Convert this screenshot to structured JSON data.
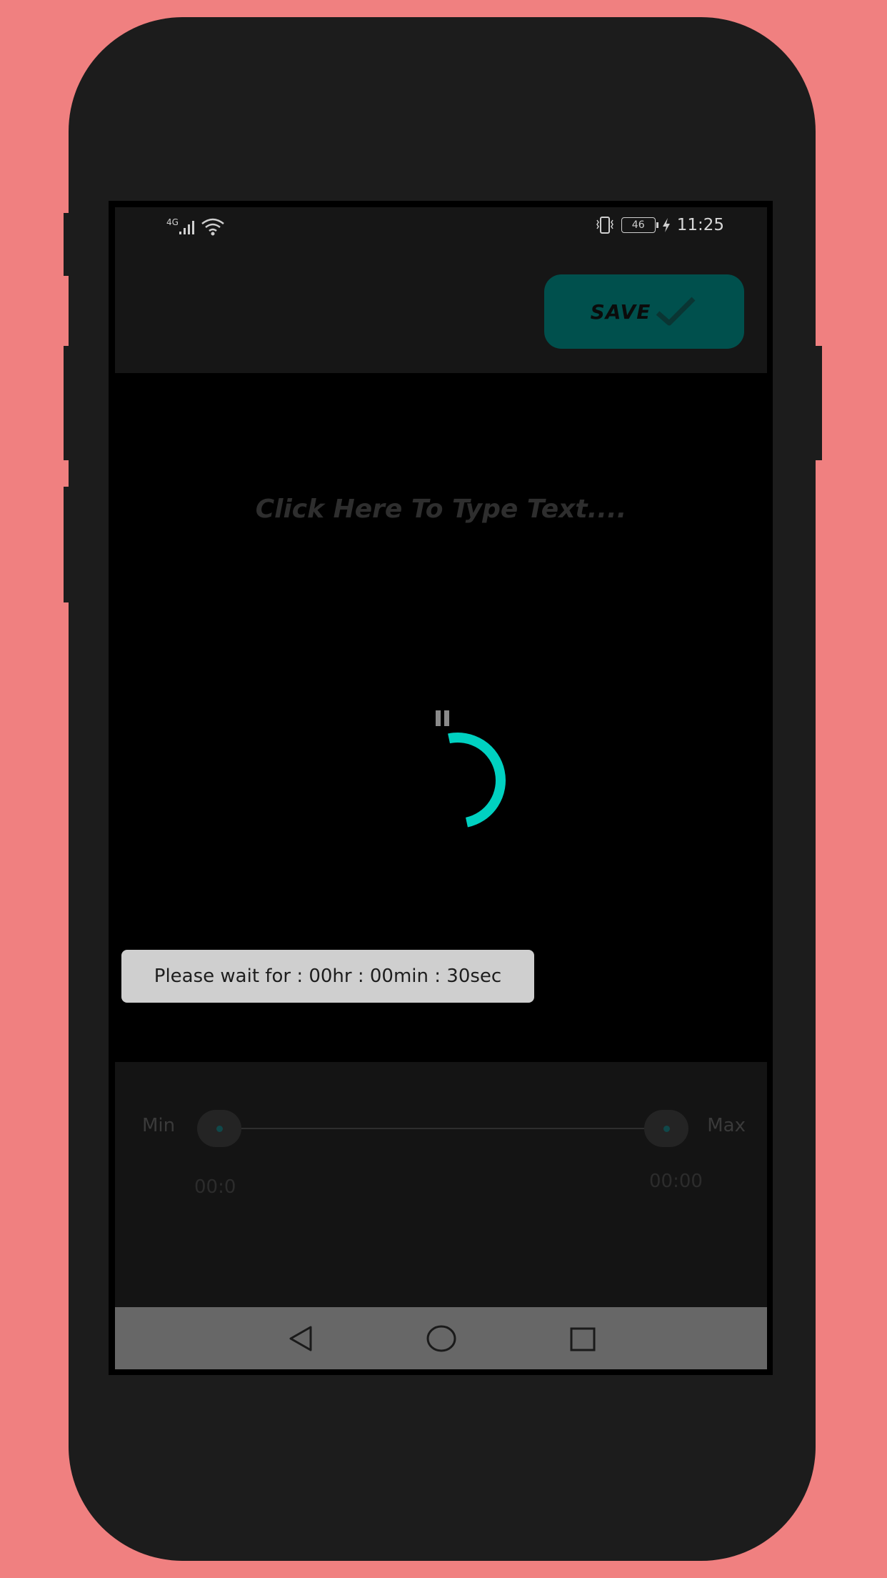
{
  "status_bar": {
    "network": "4G",
    "battery": "46",
    "time": "11:25"
  },
  "toolbar": {
    "save_label": "SAVE"
  },
  "editor": {
    "placeholder": "Click Here To Type Text...."
  },
  "range_slider": {
    "min_label": "Min",
    "max_label": "Max",
    "start_time": "00:0",
    "end_time": "00:00"
  },
  "toast": {
    "message": "Please wait for : 00hr : 00min : 30sec"
  },
  "colors": {
    "accent": "#00d1c1",
    "save_button": "#00504d"
  },
  "icons": {
    "save": "check-icon",
    "playback": "pause-icon",
    "loading": "spinner-icon",
    "nav": [
      "back-icon",
      "home-icon",
      "recents-icon"
    ]
  }
}
